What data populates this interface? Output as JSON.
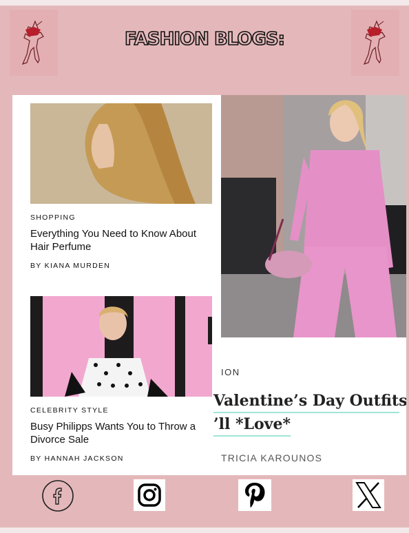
{
  "header": {
    "title": "FASHION BLOGS:"
  },
  "left_column": {
    "cards": [
      {
        "category": "SHOPPING",
        "headline": "Everything You Need to Know About Hair Perfume",
        "byline": "BY KIANA MURDEN"
      },
      {
        "category": "CELEBRITY STYLE",
        "headline": "Busy Philipps Wants You to Throw a Divorce Sale",
        "byline": "BY HANNAH JACKSON"
      }
    ]
  },
  "feature": {
    "category": "ION",
    "headline_line1": "Valentine’s Day Outfits T",
    "headline_line2": "’ll *Love*",
    "byline": "TRICIA KAROUNOS"
  },
  "social": {
    "icons": [
      "facebook-icon",
      "instagram-icon",
      "pinterest-icon",
      "x-icon"
    ]
  },
  "colors": {
    "background": "#e4b8ba",
    "logo_box": "#e3afb2",
    "accent_underline": "#9fe5d8"
  }
}
